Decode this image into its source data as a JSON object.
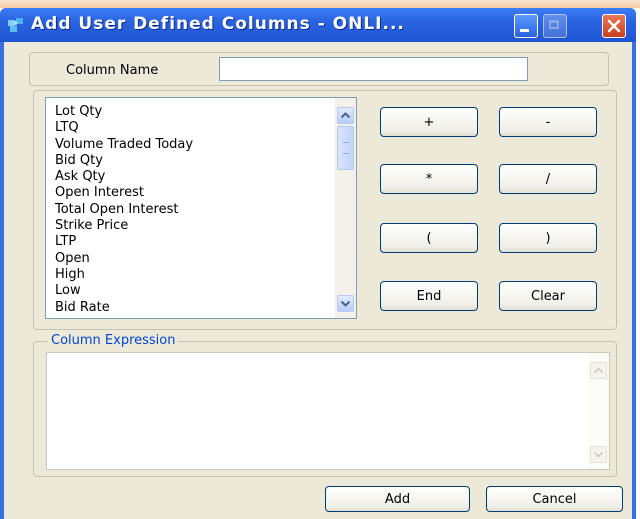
{
  "window": {
    "title": "Add User Defined Columns - ONLI...",
    "icon": "puzzle-icon",
    "controls": [
      "minimize-icon",
      "maximize-icon",
      "close-icon"
    ]
  },
  "column_name": {
    "label": "Column Name",
    "value": ""
  },
  "fields": {
    "items": [
      "Lot Qty",
      "LTQ",
      "Volume Traded Today",
      "Bid Qty",
      "Ask Qty",
      "Open Interest",
      "Total Open Interest",
      "Strike Price",
      "LTP",
      "Open",
      "High",
      "Low",
      "Bid Rate"
    ]
  },
  "operators": {
    "plus": "+",
    "minus": "-",
    "multiply": "*",
    "divide": "/",
    "open_paren": "(",
    "close_paren": ")",
    "end": "End",
    "clear": "Clear"
  },
  "expression": {
    "legend": "Column Expression",
    "value": ""
  },
  "footer": {
    "add": "Add",
    "cancel": "Cancel"
  },
  "colors": {
    "titlebar": "#2a63e0",
    "dialog_bg": "#ece9d8",
    "legend_text": "#0046d5",
    "button_border": "#003c74"
  }
}
